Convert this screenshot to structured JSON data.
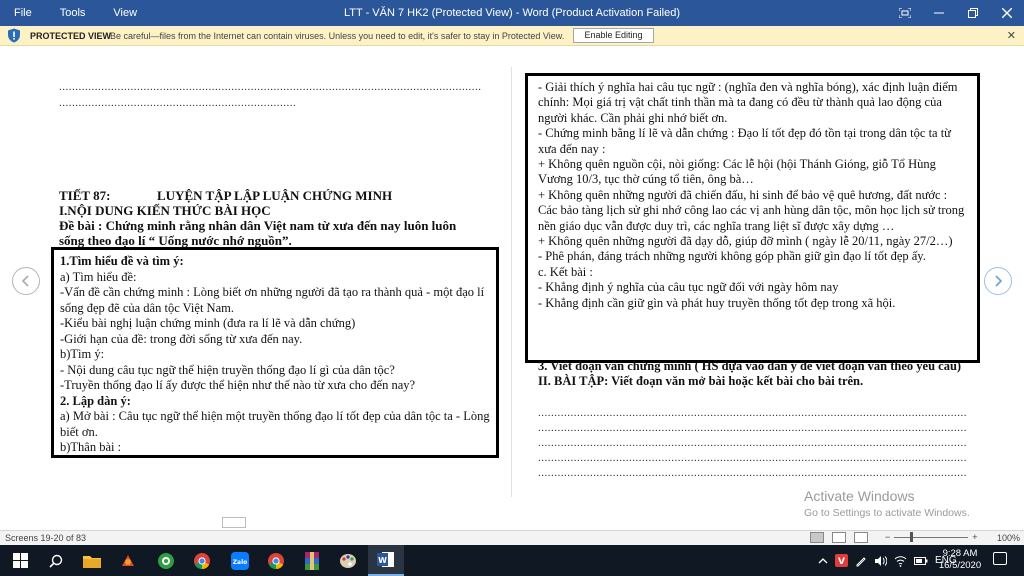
{
  "titlebar": {
    "menu": [
      "File",
      "Tools",
      "View"
    ],
    "title": "LTT - VĂN 7 HK2 (Protected View) - Word (Product Activation Failed)",
    "controls": [
      "focus-icon",
      "minimize-icon",
      "restore-icon",
      "close-icon"
    ]
  },
  "protected_view": {
    "label": "PROTECTED VIEW",
    "message": "Be careful—files from the Internet can contain viruses. Unless you need to edit, it's safer to stay in Protected View.",
    "button": "Enable Editing",
    "close": "✕"
  },
  "left_page": {
    "dots1": "..................................................................................................................................",
    "dots2": "......................................................................................",
    "tiet": "TIẾT 87:",
    "lesson_title": "LUYỆN TẬP LẬP LUẬN CHỨNG MINH",
    "section1": "I.NỘI DUNG KIẾN THỨC BÀI HỌC",
    "de_bai": "Đề bài : Chứng minh rằng nhân dân Việt nam từ xưa đến nay luôn luôn sống theo đạo lí “ Uống nước nhớ nguồn”.",
    "box_lines": [
      "1.Tìm hiểu đề và tìm ý:",
      "a) Tìm hiểu đề:",
      "-Vấn đề cần chứng minh : Lòng biết ơn những người đã tạo ra thành quả - một đạo lí sống đẹp đẽ của dân tộc Việt Nam.",
      "-Kiểu bài nghị luận chứng minh (đưa ra lí lẽ và dẫn chứng)",
      "-Giới hạn của đề: trong đời sống từ xưa đến nay.",
      "b)Tìm ý:",
      "-  Nội dung câu tục ngữ thể hiện truyền thống đạo lí gì của dân tộc?",
      "-Truyền thống đạo lí ấy được thể hiện như thế nào từ xưa cho đến nay?",
      "2. Lập dàn ý:",
      " a) Mở bài : Câu tục ngữ thể hiện một truyền thống đạo lí tốt đẹp của dân tộc ta - Lòng biết ơn.",
      "  b)Thân bài :"
    ]
  },
  "right_page": {
    "box_lines": [
      " - Giải thích ý nghĩa hai câu tục ngữ :  (nghĩa đen và nghĩa bóng), xác định luận điểm chính: Mọi giá trị vật chất tinh thần mà ta đang có đều từ thành quả lao động của người khác. Cần phải ghi nhớ biết ơn.",
      "- Chứng minh bằng lí lẽ và dẫn chứng : Đạo lí tốt đẹp đó tồn tại trong dân tộc ta từ xưa đến nay :",
      "+ Không quên nguồn cội, nòi giống: Các lễ hội (hội Thánh Gióng, giỗ Tổ Hùng Vương 10/3, tục thờ cúng tổ tiên, ông bà…",
      " + Không quên những người đã chiến đấu, hi sinh để bảo vệ quê hương, đất nước : Các bảo tàng lịch sử ghi nhớ công lao các vị anh hùng dân tộc, môn học lịch sử trong nền giáo dục vẫn được duy trì, các nghĩa trang liệt sĩ được xây dựng …",
      "+ Không quên những người đã dạy dỗ, giúp đỡ mình ( ngày lễ 20/11, ngày 27/2…)",
      " - Phê phán, đáng trách những người không góp phần giữ gìn đạo lí tốt đẹp ấy.",
      "     c. Kết bài :",
      "-   Khẳng định ý nghĩa của câu tục ngữ đối với ngày hôm  nay",
      "-   Khẳng định  cần giữ gìn và phát huy truyền thống tốt đẹp trong xã hội."
    ],
    "below_line1": "3. Viết đoạn văn chứng minh ( HS dựa vào dàn ý để viết đoạn văn theo yêu cầu)",
    "exercise": "II. BÀI TẬP: Viết đoạn văn mở bài hoặc kết bài cho bài trên.",
    "dots": "......................................................................................................................................"
  },
  "activate": {
    "title": "Activate Windows",
    "subtitle": "Go to Settings to activate Windows."
  },
  "statusbar": {
    "pages": "Screens 19-20 of 83",
    "zoom_minus": "−",
    "zoom_plus": "+",
    "zoom": "100%"
  },
  "taskbar": {
    "time": "9:28 AM",
    "date": "16/5/2020",
    "lang": "ENG"
  }
}
